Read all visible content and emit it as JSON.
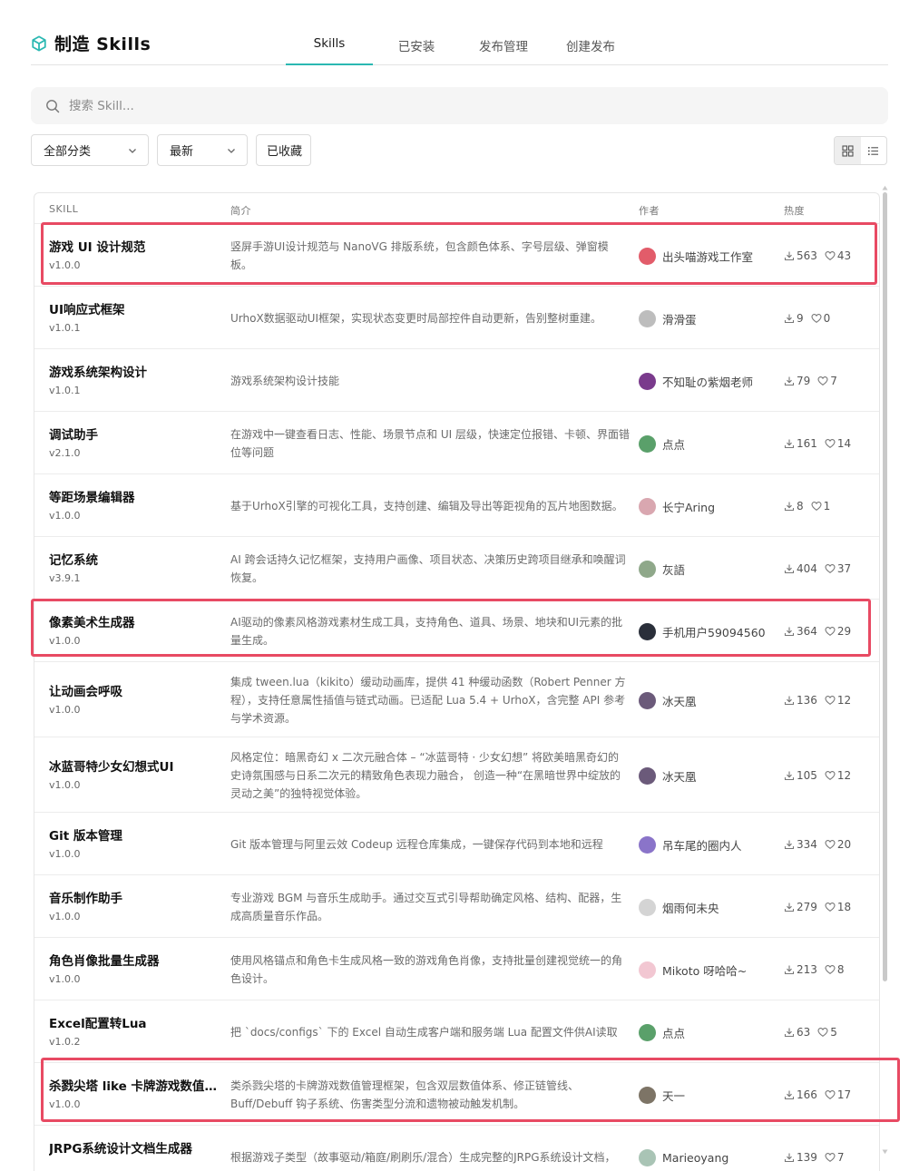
{
  "header": {
    "title": "制造 Skills",
    "tabs": [
      "Skills",
      "已安装",
      "发布管理",
      "创建发布"
    ]
  },
  "search": {
    "placeholder": "搜索 Skill..."
  },
  "filters": {
    "category": "全部分类",
    "sort": "最新",
    "favorites": "已收藏"
  },
  "table": {
    "columns": [
      "SKILL",
      "简介",
      "作者",
      "热度"
    ],
    "rows": [
      {
        "name": "游戏 UI 设计规范",
        "version": "v1.0.0",
        "desc": "竖屏手游UI设计规范与 NanoVG 排版系统，包含颜色体系、字号层级、弹窗模板。",
        "author": "出头喵游戏工作室",
        "downloads": "563",
        "likes": "43",
        "avatar": "#e25c6a"
      },
      {
        "name": "UI响应式框架",
        "version": "v1.0.1",
        "desc": "UrhoX数据驱动UI框架，实现状态变更时局部控件自动更新，告别整树重建。",
        "author": "滑滑蛋",
        "downloads": "9",
        "likes": "0",
        "avatar": "#bdbdbd"
      },
      {
        "name": "游戏系统架构设计",
        "version": "v1.0.1",
        "desc": "游戏系统架构设计技能",
        "author": "不知耻の紫烟老师",
        "downloads": "79",
        "likes": "7",
        "avatar": "#7a3a8c"
      },
      {
        "name": "调试助手",
        "version": "v2.1.0",
        "desc": "在游戏中一键查看日志、性能、场景节点和 UI 层级，快速定位报错、卡顿、界面错位等问题",
        "author": "点点",
        "downloads": "161",
        "likes": "14",
        "avatar": "#5aa06a"
      },
      {
        "name": "等距场景编辑器",
        "version": "v1.0.0",
        "desc": "基于UrhoX引擎的可视化工具，支持创建、编辑及导出等距视角的瓦片地图数据。",
        "author": "长宁Aring",
        "downloads": "8",
        "likes": "1",
        "avatar": "#d9a7b0"
      },
      {
        "name": "记忆系统",
        "version": "v3.9.1",
        "desc": "AI 跨会话持久记忆框架，支持用户画像、项目状态、决策历史跨项目继承和唤醒词恢复。",
        "author": "灰語",
        "downloads": "404",
        "likes": "37",
        "avatar": "#8fa88a"
      },
      {
        "name": "像素美术生成器",
        "version": "v1.0.0",
        "desc": "AI驱动的像素风格游戏素材生成工具，支持角色、道具、场景、地块和UI元素的批量生成。",
        "author": "手机用户59094560",
        "downloads": "364",
        "likes": "29",
        "avatar": "#2a2f3a"
      },
      {
        "name": "让动画会呼吸",
        "version": "v1.0.0",
        "desc": "集成 tween.lua（kikito）缓动动画库，提供 41 种缓动函数（Robert Penner 方程），支持任意属性插值与链式动画。已适配 Lua 5.4 + UrhoX，含完整 API 参考与学术资源。",
        "author": "冰天凰",
        "downloads": "136",
        "likes": "12",
        "avatar": "#6b5a7a"
      },
      {
        "name": "冰蓝哥特少女幻想式UI",
        "version": "v1.0.0",
        "desc": "风格定位：暗黑奇幻 x 二次元融合体 – “冰蓝哥特 · 少女幻想” 将欧美暗黑奇幻的史诗氛围感与日系二次元的精致角色表现力融合， 创造一种“在黑暗世界中绽放的灵动之美”的独特视觉体验。",
        "author": "冰天凰",
        "downloads": "105",
        "likes": "12",
        "avatar": "#6b5a7a"
      },
      {
        "name": "Git 版本管理",
        "version": "v1.0.0",
        "desc": "Git 版本管理与阿里云效 Codeup 远程仓库集成，一键保存代码到本地和远程",
        "author": "吊车尾的圈内人",
        "downloads": "334",
        "likes": "20",
        "avatar": "#8a74c9"
      },
      {
        "name": "音乐制作助手",
        "version": "v1.0.0",
        "desc": "专业游戏 BGM 与音乐生成助手。通过交互式引导帮助确定风格、结构、配器，生成高质量音乐作品。",
        "author": "烟雨何未央",
        "downloads": "279",
        "likes": "18",
        "avatar": "#d4d4d4"
      },
      {
        "name": "角色肖像批量生成器",
        "version": "v1.0.0",
        "desc": "使用风格锚点和角色卡生成风格一致的游戏角色肖像，支持批量创建视觉统一的角色设计。",
        "author": "Mikoto 呀哈哈~",
        "downloads": "213",
        "likes": "8",
        "avatar": "#f2c7d2"
      },
      {
        "name": "Excel配置转Lua",
        "version": "v1.0.2",
        "desc": "把 `docs/configs` 下的 Excel 自动生成客户端和服务端 Lua 配置文件供AI读取",
        "author": "点点",
        "downloads": "63",
        "likes": "5",
        "avatar": "#5aa06a"
      },
      {
        "name": "杀戮尖塔 like 卡牌游戏数值管理框架",
        "version": "v1.0.0",
        "desc": "类杀戮尖塔的卡牌游戏数值管理框架，包含双层数值体系、修正链管线、Buff/Debuff 钩子系统、伤害类型分流和遗物被动触发机制。",
        "author": "天一",
        "downloads": "166",
        "likes": "17",
        "avatar": "#7d7466"
      },
      {
        "name": "JRPG系统设计文档生成器",
        "version": "",
        "desc": "根据游戏子类型（故事驱动/箱庭/刷刷乐/混合）生成完整的JRPG系统设计文档，",
        "author": "Marieoyang",
        "downloads": "139",
        "likes": "7",
        "avatar": "#a9c4b5"
      }
    ]
  }
}
